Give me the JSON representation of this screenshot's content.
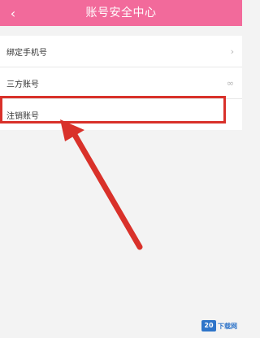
{
  "header": {
    "back_icon": "chevron-left-icon",
    "title": "账号安全中心",
    "background": "#f26a9b"
  },
  "list": {
    "items": [
      {
        "label": "绑定手机号",
        "right_icon": "chevron-right-icon",
        "right_glyph": "›"
      },
      {
        "label": "三方账号",
        "right_icon": "link-icon",
        "right_glyph": "∞"
      },
      {
        "label": "注销账号"
      }
    ]
  },
  "annotation": {
    "highlight_color": "#d9312a",
    "arrow_color": "#d9312a"
  },
  "watermark": {
    "badge": "20",
    "text": "下载网"
  }
}
